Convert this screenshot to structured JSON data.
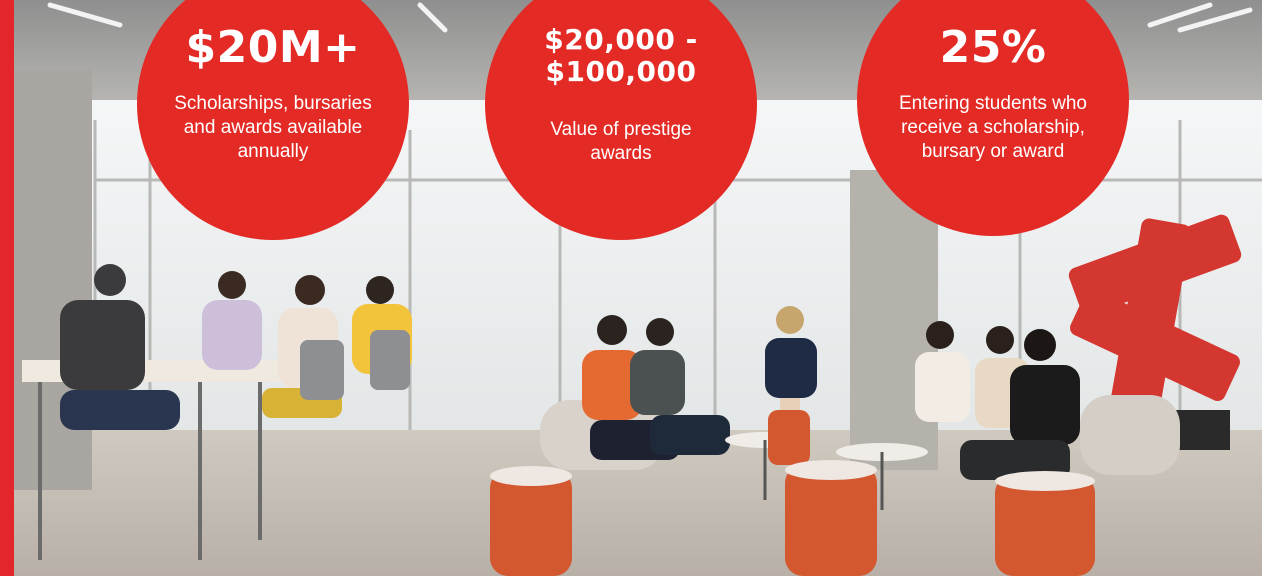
{
  "accent_color": "#e3262b",
  "stats": [
    {
      "value": "$20M+",
      "description": "Scholarships, bursaries and awards available annually"
    },
    {
      "value": "$20,000 - $100,000",
      "description": "Value of prestige awards"
    },
    {
      "value": "25%",
      "description": "Entering students who receive a scholarship, bursary or award"
    }
  ],
  "photo": {
    "subject": "student-lounge-photo"
  }
}
